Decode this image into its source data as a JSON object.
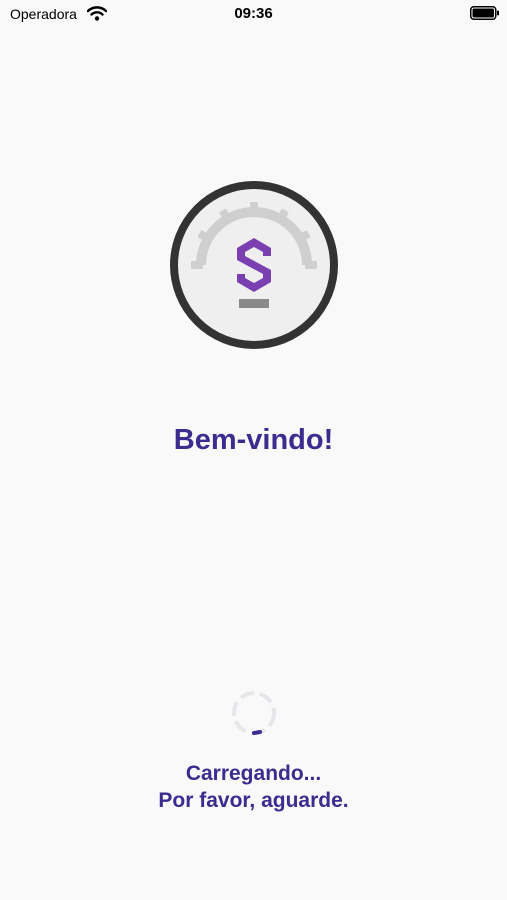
{
  "status_bar": {
    "carrier": "Operadora",
    "time": "09:36"
  },
  "splash": {
    "welcome": "Bem-vindo!",
    "loading_line1": "Carregando...",
    "loading_line2": "Por favor, aguarde."
  },
  "icons": {
    "wifi": "wifi-icon",
    "battery": "battery-icon",
    "logo": "app-logo-gauge-icon",
    "spinner": "loading-spinner-icon"
  },
  "colors": {
    "accent": "#3d2b8f",
    "logo_purple": "#7a3fb0",
    "ring": "#333333",
    "background": "#f9f9f9"
  }
}
